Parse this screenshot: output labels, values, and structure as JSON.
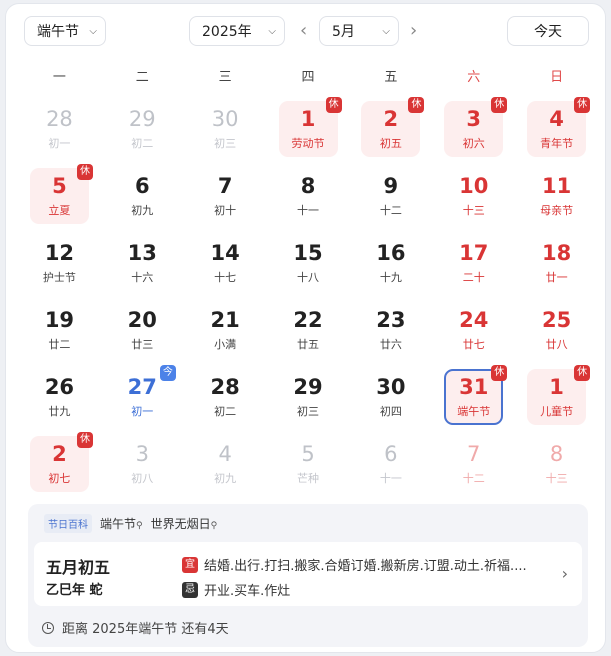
{
  "toolbar": {
    "holiday_select": "端午节",
    "year_select": "2025年",
    "month_select": "5月",
    "prev": "‹",
    "next": "›",
    "today_label": "今天",
    "chevron": "⌵"
  },
  "weekdays": [
    "一",
    "二",
    "三",
    "四",
    "五",
    "六",
    "日"
  ],
  "weeks": [
    [
      {
        "n": "28",
        "l": "初一",
        "other": true
      },
      {
        "n": "29",
        "l": "初二",
        "other": true
      },
      {
        "n": "30",
        "l": "初三",
        "other": true
      },
      {
        "n": "1",
        "l": "劳动节",
        "red": true,
        "hol": true,
        "badge": "休"
      },
      {
        "n": "2",
        "l": "初五",
        "red": true,
        "hol": true,
        "badge": "休"
      },
      {
        "n": "3",
        "l": "初六",
        "red": true,
        "hol": true,
        "badge": "休"
      },
      {
        "n": "4",
        "l": "青年节",
        "red": true,
        "hol": true,
        "badge": "休"
      }
    ],
    [
      {
        "n": "5",
        "l": "立夏",
        "red": true,
        "hol": true,
        "badge": "休"
      },
      {
        "n": "6",
        "l": "初九"
      },
      {
        "n": "7",
        "l": "初十"
      },
      {
        "n": "8",
        "l": "十一"
      },
      {
        "n": "9",
        "l": "十二"
      },
      {
        "n": "10",
        "l": "十三",
        "red": true
      },
      {
        "n": "11",
        "l": "母亲节",
        "red": true
      }
    ],
    [
      {
        "n": "12",
        "l": "护士节"
      },
      {
        "n": "13",
        "l": "十六"
      },
      {
        "n": "14",
        "l": "十七"
      },
      {
        "n": "15",
        "l": "十八"
      },
      {
        "n": "16",
        "l": "十九"
      },
      {
        "n": "17",
        "l": "二十",
        "red": true
      },
      {
        "n": "18",
        "l": "廿一",
        "red": true
      }
    ],
    [
      {
        "n": "19",
        "l": "廿二"
      },
      {
        "n": "20",
        "l": "廿三"
      },
      {
        "n": "21",
        "l": "小满"
      },
      {
        "n": "22",
        "l": "廿五"
      },
      {
        "n": "23",
        "l": "廿六"
      },
      {
        "n": "24",
        "l": "廿七",
        "red": true
      },
      {
        "n": "25",
        "l": "廿八",
        "red": true
      }
    ],
    [
      {
        "n": "26",
        "l": "廿九"
      },
      {
        "n": "27",
        "l": "初一",
        "today": true,
        "badge": "今"
      },
      {
        "n": "28",
        "l": "初二"
      },
      {
        "n": "29",
        "l": "初三"
      },
      {
        "n": "30",
        "l": "初四"
      },
      {
        "n": "31",
        "l": "端午节",
        "red": true,
        "selected": true,
        "badge": "休"
      },
      {
        "n": "1",
        "l": "儿童节",
        "red": true,
        "hol": true,
        "badge": "休"
      }
    ],
    [
      {
        "n": "2",
        "l": "初七",
        "red": true,
        "hol": true,
        "badge": "休"
      },
      {
        "n": "3",
        "l": "初八",
        "other": true
      },
      {
        "n": "4",
        "l": "初九",
        "other": true
      },
      {
        "n": "5",
        "l": "芒种",
        "other": true
      },
      {
        "n": "6",
        "l": "十一",
        "other": true
      },
      {
        "n": "7",
        "l": "十二",
        "other": true,
        "red": true
      },
      {
        "n": "8",
        "l": "十三",
        "other": true,
        "red": true
      }
    ]
  ],
  "info": {
    "tag_head": "节日百科",
    "tags": [
      "端午节",
      "世界无烟日"
    ],
    "lunar_date": "五月初五",
    "ganzhi": "乙巳年 蛇",
    "yi_label": "宜",
    "yi_text": "结婚.出行.打扫.搬家.合婚订婚.搬新房.订盟.动土.祈福....",
    "ji_label": "忌",
    "ji_text": "开业.买车.作灶",
    "countdown": "距离 2025年端午节 还有4天",
    "chevron": "›"
  }
}
